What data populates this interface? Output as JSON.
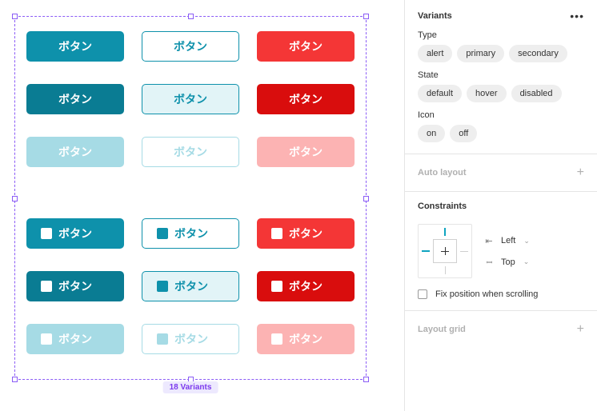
{
  "button_label": "ボタン",
  "variant_count_badge": "18 Variants",
  "panel": {
    "variants": {
      "title": "Variants",
      "props": [
        {
          "label": "Type",
          "values": [
            "alert",
            "primary",
            "secondary"
          ]
        },
        {
          "label": "State",
          "values": [
            "default",
            "hover",
            "disabled"
          ]
        },
        {
          "label": "Icon",
          "values": [
            "on",
            "off"
          ]
        }
      ]
    },
    "auto_layout_title": "Auto layout",
    "constraints": {
      "title": "Constraints",
      "horizontal": "Left",
      "vertical": "Top",
      "fix_label": "Fix position when scrolling"
    },
    "layout_grid_title": "Layout grid"
  },
  "grid": [
    {
      "cls": "primary-default",
      "icon": false
    },
    {
      "cls": "secondary-default",
      "icon": false
    },
    {
      "cls": "alert-default",
      "icon": false
    },
    {
      "cls": "primary-hover",
      "icon": false
    },
    {
      "cls": "secondary-hover",
      "icon": false
    },
    {
      "cls": "alert-hover",
      "icon": false
    },
    {
      "cls": "primary-disabled",
      "icon": false
    },
    {
      "cls": "secondary-disabled",
      "icon": false
    },
    {
      "cls": "alert-disabled",
      "icon": false
    },
    {
      "cls": "primary-default",
      "icon": true
    },
    {
      "cls": "secondary-default",
      "icon": true
    },
    {
      "cls": "alert-default",
      "icon": true
    },
    {
      "cls": "primary-hover",
      "icon": true
    },
    {
      "cls": "secondary-hover",
      "icon": true
    },
    {
      "cls": "alert-hover",
      "icon": true
    },
    {
      "cls": "primary-disabled",
      "icon": true
    },
    {
      "cls": "secondary-disabled",
      "icon": true
    },
    {
      "cls": "alert-disabled",
      "icon": true
    }
  ]
}
